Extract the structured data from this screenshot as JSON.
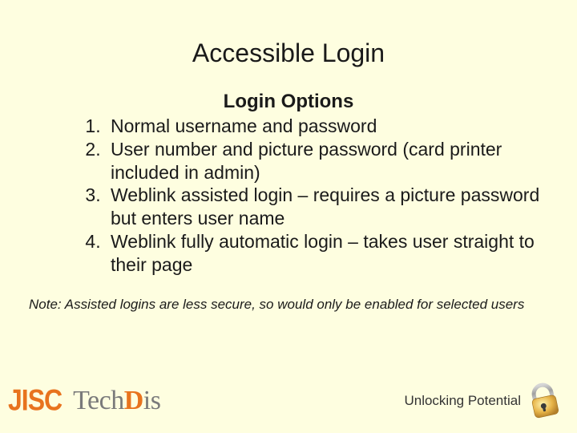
{
  "slide": {
    "title": "Accessible Login",
    "subtitle": "Login Options",
    "options": {
      "0": "Normal username and password",
      "1": "User number and picture password (card printer included in admin)",
      "2": "Weblink assisted login – requires a picture password but enters user name",
      "3": "Weblink fully automatic login – takes user straight to their page"
    },
    "note": "Note: Assisted logins are less secure, so would only be enabled for selected users",
    "footer": {
      "jisc": "JISC",
      "tech": "Tech",
      "d": "D",
      "is": "is",
      "tagline": "Unlocking Potential"
    }
  }
}
